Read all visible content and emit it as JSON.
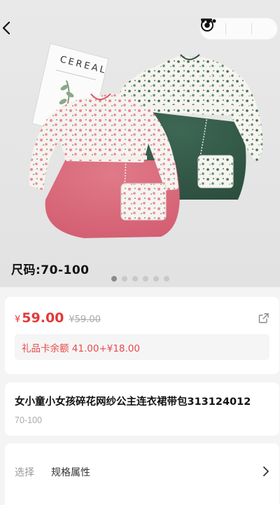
{
  "nav": {
    "back_icon": "chevron-left-icon",
    "capsule": {
      "more_icon": "more-dots-icon",
      "minimize_icon": "minimize-icon",
      "close_icon": "target-close-icon"
    }
  },
  "gallery": {
    "book_title": "CEREAL",
    "size_caption": "尺码:70-100",
    "dot_count": 6,
    "active_index": 0
  },
  "price": {
    "currency": "¥",
    "current": "59.00",
    "original": "¥59.00",
    "share_icon": "share-icon",
    "gift_card_text": "礼品卡余额 41.00+¥18.00",
    "accent_color": "#e23a3a"
  },
  "product": {
    "title": "女小童小女孩碎花网纱公主连衣裙带包313124012",
    "size_range": "70-100"
  },
  "spec": {
    "label": "选择",
    "value": "规格属性",
    "arrow_icon": "chevron-right-icon"
  }
}
